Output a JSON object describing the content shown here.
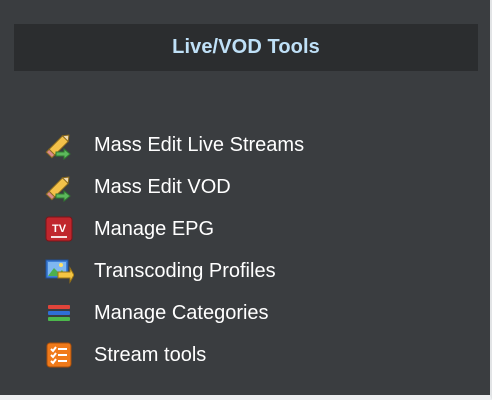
{
  "panel": {
    "title": "Live/VOD Tools",
    "colors": {
      "background": "#3a3d40",
      "header_background": "#2b2d2f",
      "title": "#bfe0f7",
      "item_text": "#ffffff"
    }
  },
  "menu": {
    "items": [
      {
        "label": "Mass Edit Live Streams",
        "icon": "pencil-edit-icon"
      },
      {
        "label": "Mass Edit VOD",
        "icon": "pencil-edit-icon"
      },
      {
        "label": "Manage EPG",
        "icon": "tv-icon"
      },
      {
        "label": "Transcoding Profiles",
        "icon": "video-convert-icon"
      },
      {
        "label": "Manage Categories",
        "icon": "category-list-icon"
      },
      {
        "label": "Stream tools",
        "icon": "checklist-icon"
      }
    ]
  }
}
